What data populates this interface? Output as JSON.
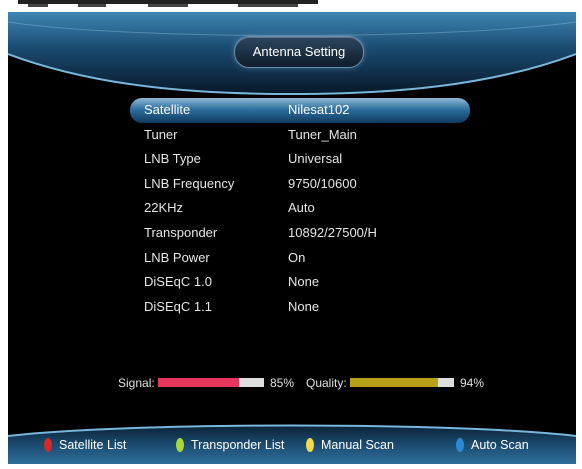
{
  "screen": {
    "title": "Antenna Setting"
  },
  "settings": [
    {
      "label": "Satellite",
      "value": "Nilesat102"
    },
    {
      "label": "Tuner",
      "value": "Tuner_Main"
    },
    {
      "label": "LNB Type",
      "value": "Universal"
    },
    {
      "label": "LNB Frequency",
      "value": "9750/10600"
    },
    {
      "label": "22KHz",
      "value": "Auto"
    },
    {
      "label": "Transponder",
      "value": "10892/27500/H"
    },
    {
      "label": "LNB Power",
      "value": "On"
    },
    {
      "label": "DiSEqC 1.0",
      "value": "None"
    },
    {
      "label": "DiSEqC 1.1",
      "value": "None"
    }
  ],
  "meters": {
    "signal": {
      "label": "Signal:",
      "level": 85,
      "value_text": "85%",
      "color": "#e8365c"
    },
    "quality": {
      "label": "Quality:",
      "level": 94,
      "value_text": "94%",
      "color": "#b8a018"
    }
  },
  "footer": [
    {
      "label": "Satellite List",
      "key_color": "#d42a2a",
      "icon": "red-key-icon"
    },
    {
      "label": "Transponder List",
      "key_color": "#a8d83a",
      "icon": "green-key-icon"
    },
    {
      "label": "Manual Scan",
      "key_color": "#f2da4a",
      "icon": "yellow-key-icon"
    },
    {
      "label": "Auto Scan",
      "key_color": "#2a8ad8",
      "icon": "blue-key-icon"
    }
  ],
  "colors": {
    "selected_row": "#2f6f9f",
    "band": "#1d4a6e"
  }
}
